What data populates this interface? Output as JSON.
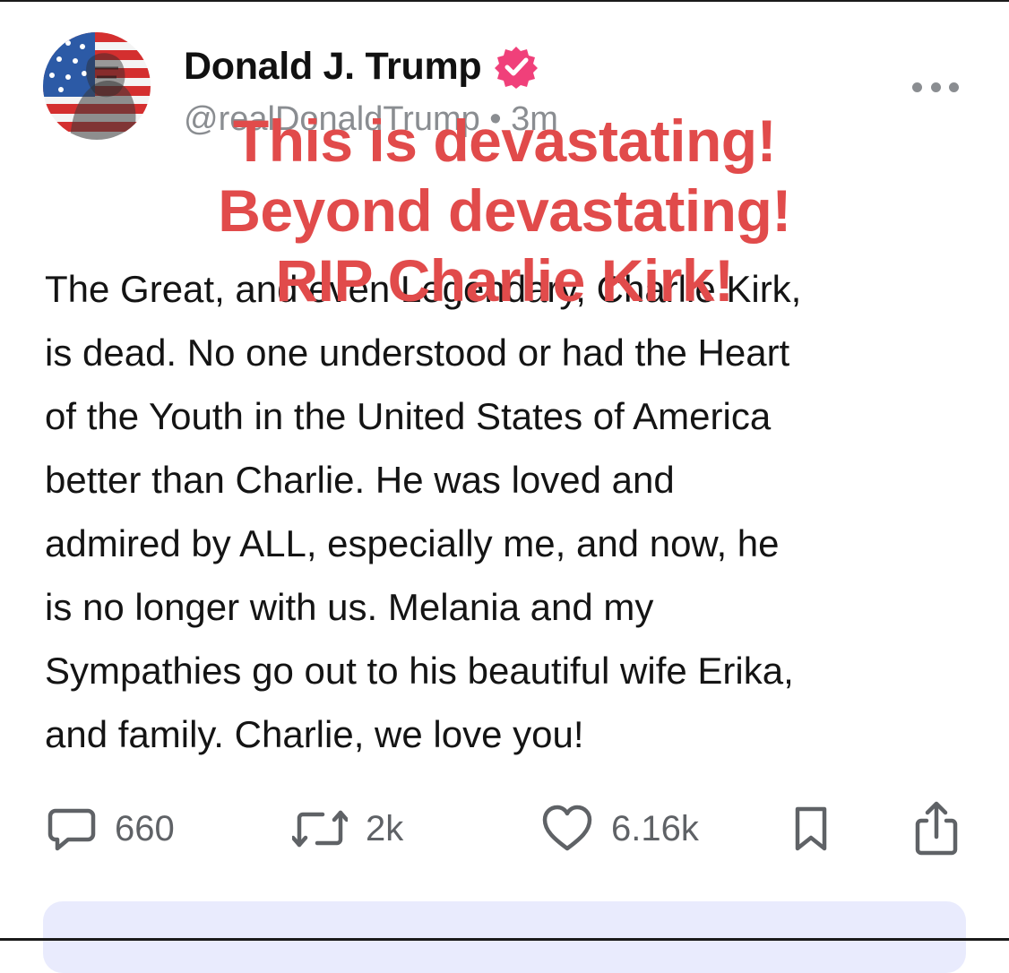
{
  "post": {
    "author": {
      "display_name": "Donald J. Trump",
      "handle_meta": "@realDonaldTrump • 3m",
      "verified": true,
      "avatar_icon": "flag-portrait-avatar",
      "verified_icon": "verified-badge-icon",
      "accent_color": "#f0407a"
    },
    "more_icon": "more-dots-icon",
    "overlay_caption": {
      "line1": "This is devastating!",
      "line2": "Beyond devastating!",
      "line3": "RIP Charlie Kirk!",
      "color": "#e14b4b"
    },
    "body_lines": [
      "The Great, and even Legendary, Charlie Kirk,",
      "is dead. No one understood or had the Heart",
      "of the Youth in the United States of America",
      "better than Charlie. He was loved and",
      "admired by ALL, especially me, and now, he",
      "is no longer with us. Melania and my",
      "Sympathies go out to his beautiful wife Erika,",
      "and family. Charlie, we love you!"
    ],
    "actions": {
      "reply": {
        "icon": "reply-icon",
        "count": "660"
      },
      "repost": {
        "icon": "repost-icon",
        "count": "2k"
      },
      "like": {
        "icon": "heart-icon",
        "count": "6.16k"
      },
      "bookmark": {
        "icon": "bookmark-icon"
      },
      "share": {
        "icon": "share-icon"
      }
    }
  },
  "colors": {
    "text_primary": "#141414",
    "text_secondary": "#8a8d91",
    "compose_bg": "#e9ebfd"
  }
}
